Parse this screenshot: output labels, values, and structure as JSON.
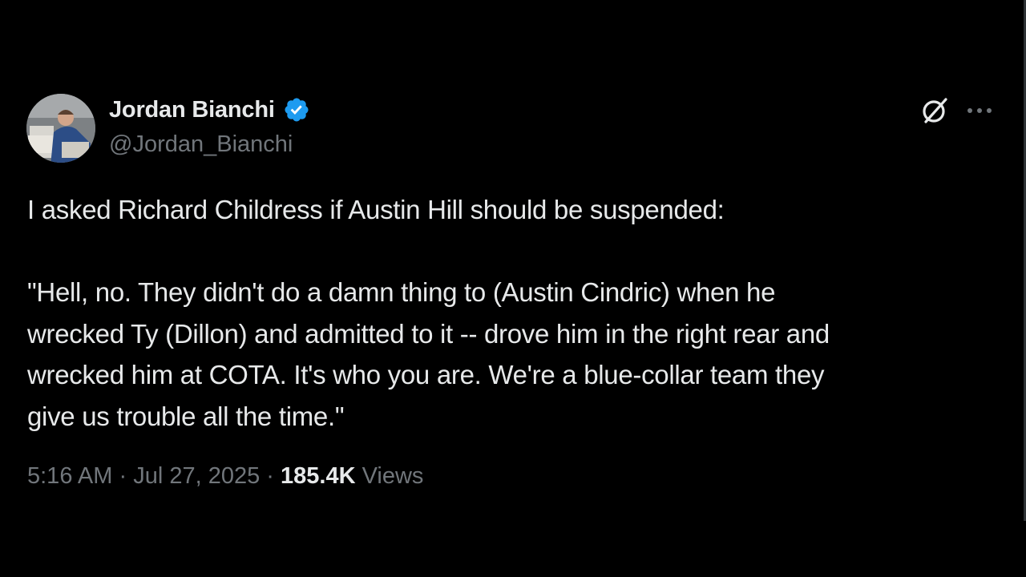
{
  "author": {
    "name": "Jordan Bianchi",
    "handle": "@Jordan_Bianchi",
    "verified": true,
    "verified_color": "#1d9bf0"
  },
  "tweet": {
    "line1": "I asked Richard Childress if Austin Hill should be suspended:",
    "quote_lines": [
      "\"Hell, no. They didn't do a damn thing to (Austin Cindric) when he",
      "wrecked Ty (Dillon) and admitted to it -- drove him in the right rear and",
      "wrecked him at COTA. It's who you are. We're a blue-collar team they",
      "give us trouble all the time.\""
    ]
  },
  "meta": {
    "time": "5:16 AM",
    "separator": "·",
    "date": "Jul 27, 2025",
    "views_count": "185.4K",
    "views_label": "Views"
  },
  "icons": {
    "avatar": "avatar-photo",
    "verified": "verified-badge-icon",
    "grok": "grok-icon",
    "more": "more-options-icon"
  },
  "colors": {
    "background": "#000000",
    "text": "#e7e9ea",
    "secondary": "#71767b"
  }
}
